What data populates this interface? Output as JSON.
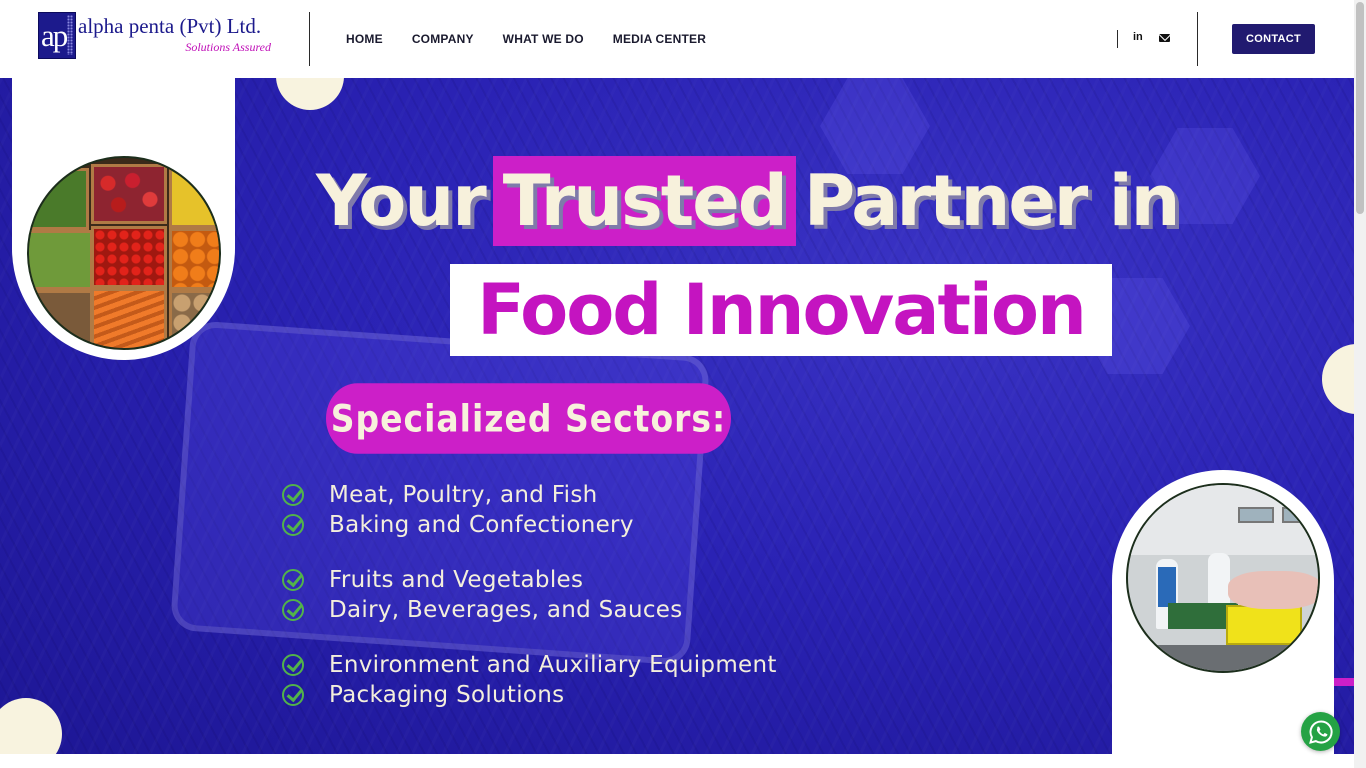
{
  "header": {
    "logo": {
      "mark": "ap",
      "company_name": "alpha penta (Pvt) Ltd.",
      "tagline": "Solutions Assured"
    },
    "nav": [
      "HOME",
      "COMPANY",
      "WHAT WE DO",
      "MEDIA CENTER"
    ],
    "social": {
      "linkedin_label": "in",
      "icons": [
        "linkedin-icon",
        "mail-icon"
      ]
    },
    "contact_label": "CONTACT"
  },
  "hero": {
    "title_part1": "Your",
    "title_highlight": "Trusted",
    "title_part2": "Partner in",
    "title_line2": "Food Innovation",
    "sectors_heading": "Specialized Sectors:",
    "sectors": [
      "Meat, Poultry, and Fish",
      "Baking and Confectionery",
      "Fruits and Vegetables",
      "Dairy, Beverages, and Sauces",
      "Environment and Auxiliary Equipment",
      "Packaging Solutions"
    ]
  },
  "colors": {
    "brand_navy": "#211a70",
    "hero_blue": "#2a22b4",
    "accent_magenta": "#cc1fc8",
    "cream": "#f7f1dc",
    "check_green": "#52b34a",
    "whatsapp_green": "#25a244"
  },
  "floating": {
    "whatsapp_icon": "whatsapp-icon"
  }
}
